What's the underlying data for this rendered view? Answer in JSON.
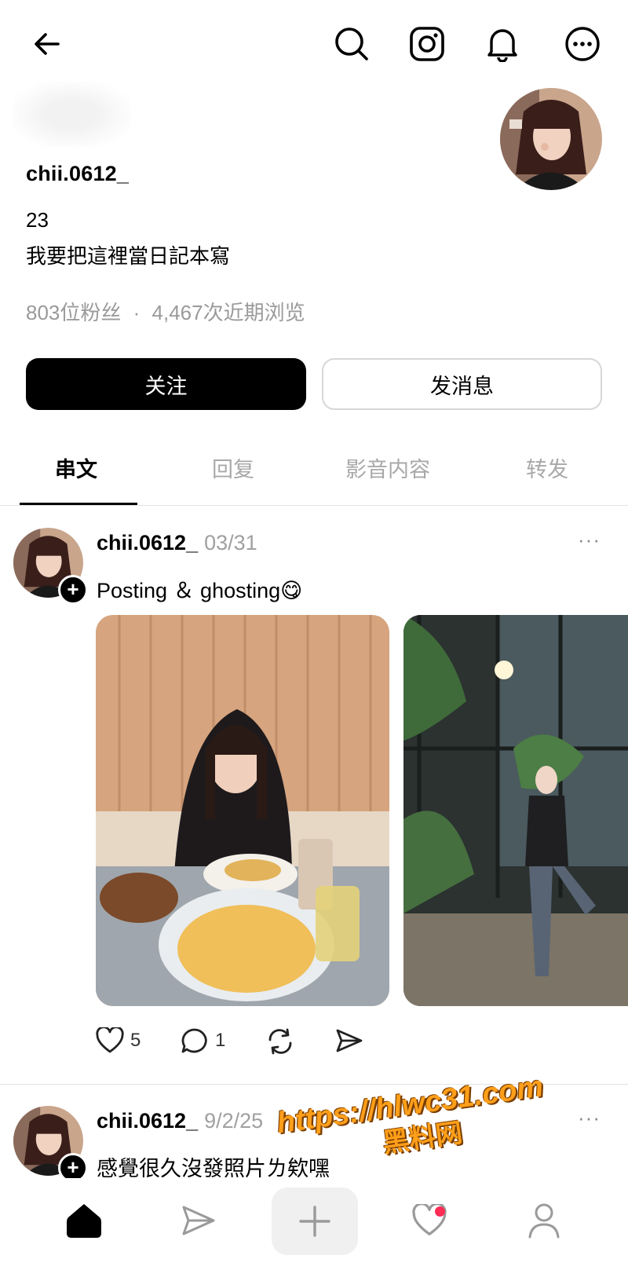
{
  "header": {
    "back_icon": "back-arrow-icon",
    "actions": [
      "search-icon",
      "instagram-icon",
      "bell-icon",
      "more-icon"
    ]
  },
  "profile": {
    "username": "chii.0612_",
    "bio_line1": "23",
    "bio_line2": "我要把這裡當日記本寫",
    "followers": "803位粉丝",
    "separator": "·",
    "views": "4,467次近期浏览"
  },
  "buttons": {
    "follow": "关注",
    "message": "发消息"
  },
  "tabs": [
    {
      "label": "串文",
      "active": true
    },
    {
      "label": "回复",
      "active": false
    },
    {
      "label": "影音内容",
      "active": false
    },
    {
      "label": "转发",
      "active": false
    }
  ],
  "posts": [
    {
      "author": "chii.0612_",
      "date": "03/31",
      "text": "Posting ＆ ghosting😋",
      "likes": "5",
      "comments": "1",
      "more": "···"
    },
    {
      "author": "chii.0612_",
      "date": "9/2/25",
      "text": "感覺很久沒發照片ㄌ欸嘿",
      "more": "···"
    }
  ],
  "watermark": {
    "url": "https://hlwc31.com",
    "label": "黑料网"
  },
  "bottom_nav": [
    "home-icon",
    "send-icon",
    "plus-icon",
    "heart-icon",
    "profile-icon"
  ],
  "colors": {
    "accent": "#000000",
    "muted": "#9a9a9a",
    "notification": "#ff2d55",
    "watermark": "#ff9f1a"
  }
}
